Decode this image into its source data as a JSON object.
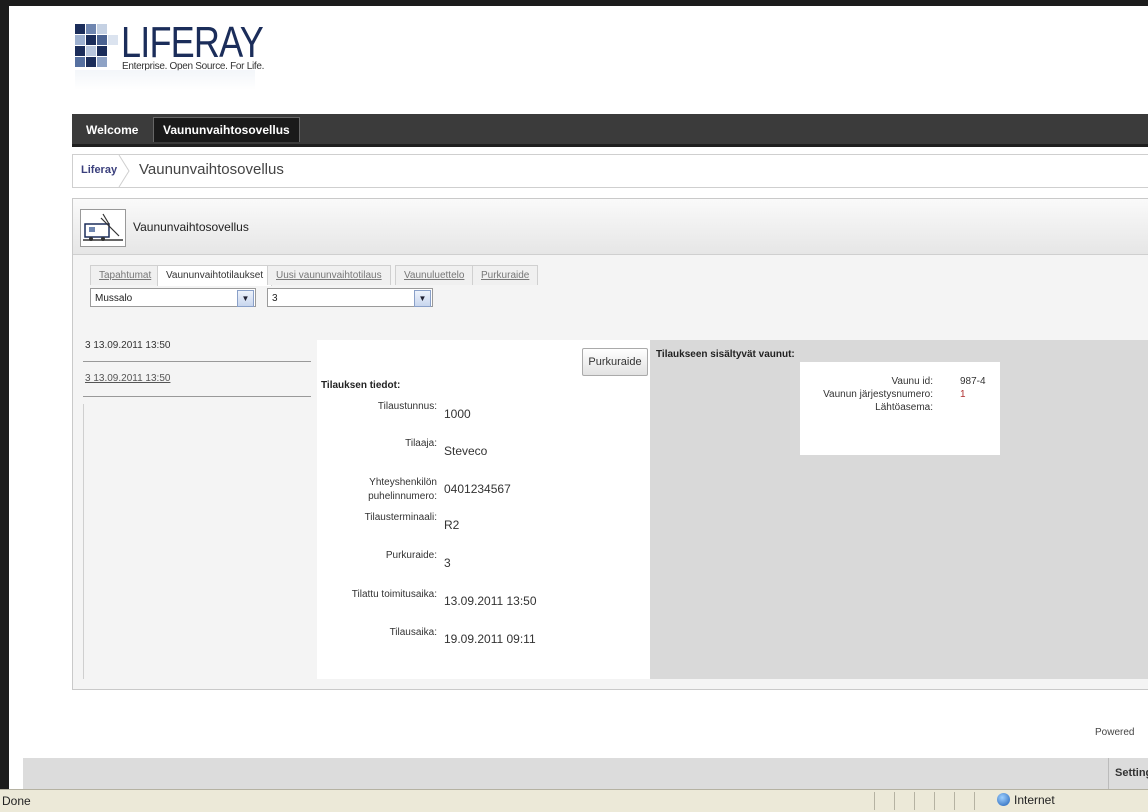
{
  "logo": {
    "name": "LIFERAY",
    "tagline": "Enterprise. Open Source. For Life."
  },
  "nav": {
    "items": [
      "Welcome",
      "Vaununvaihtosovellus"
    ]
  },
  "breadcrumb": {
    "root": "Liferay",
    "current": "Vaununvaihtosovellus"
  },
  "portlet": {
    "title": "Vaununvaihtosovellus",
    "tabs": [
      "Tapahtumat",
      "Vaununvaihtotilaukset",
      "Uusi vaununvaihtotilaus",
      "Vaunuluettelo",
      "Purkuraide"
    ],
    "active_tab": "Vaununvaihtotilaukset",
    "station_select": "Mussalo",
    "track_select": "3"
  },
  "orders": [
    "3 13.09.2011 13:50",
    "3 13.09.2011 13:50"
  ],
  "details": {
    "button": "Purkuraide",
    "heading": "Tilauksen tiedot:",
    "fields": [
      {
        "label": "Tilaustunnus:",
        "value": "1000"
      },
      {
        "label": "Tilaaja:",
        "value": "Steveco"
      },
      {
        "label1": "Yhteyshenkilön",
        "label2": "puhelinnumero:",
        "value": "0401234567"
      },
      {
        "label": "Tilausterminaali:",
        "value": "R2"
      },
      {
        "label": "Purkuraide:",
        "value": "3"
      },
      {
        "label": "Tilattu toimitusaika:",
        "value": "13.09.2011 13:50"
      },
      {
        "label": "Tilausaika:",
        "value": "19.09.2011 09:11"
      }
    ]
  },
  "wagons": {
    "heading": "Tilaukseen sisältyvät vaunut:",
    "rows": [
      {
        "label": "Vaunu id:",
        "value": "987-4"
      },
      {
        "label": "Vaunun järjestysnumero:",
        "value": "1"
      },
      {
        "label": "Lähtöasema:",
        "value": ""
      }
    ]
  },
  "footer": {
    "powered": "Powered",
    "settings": "Settings"
  },
  "statusbar": {
    "text": "Done",
    "zone": "Internet"
  },
  "colors": {
    "nav_bg": "#3b3b3b",
    "accent_red": "#b03030",
    "wagon_panel": "#d9d9d9"
  }
}
